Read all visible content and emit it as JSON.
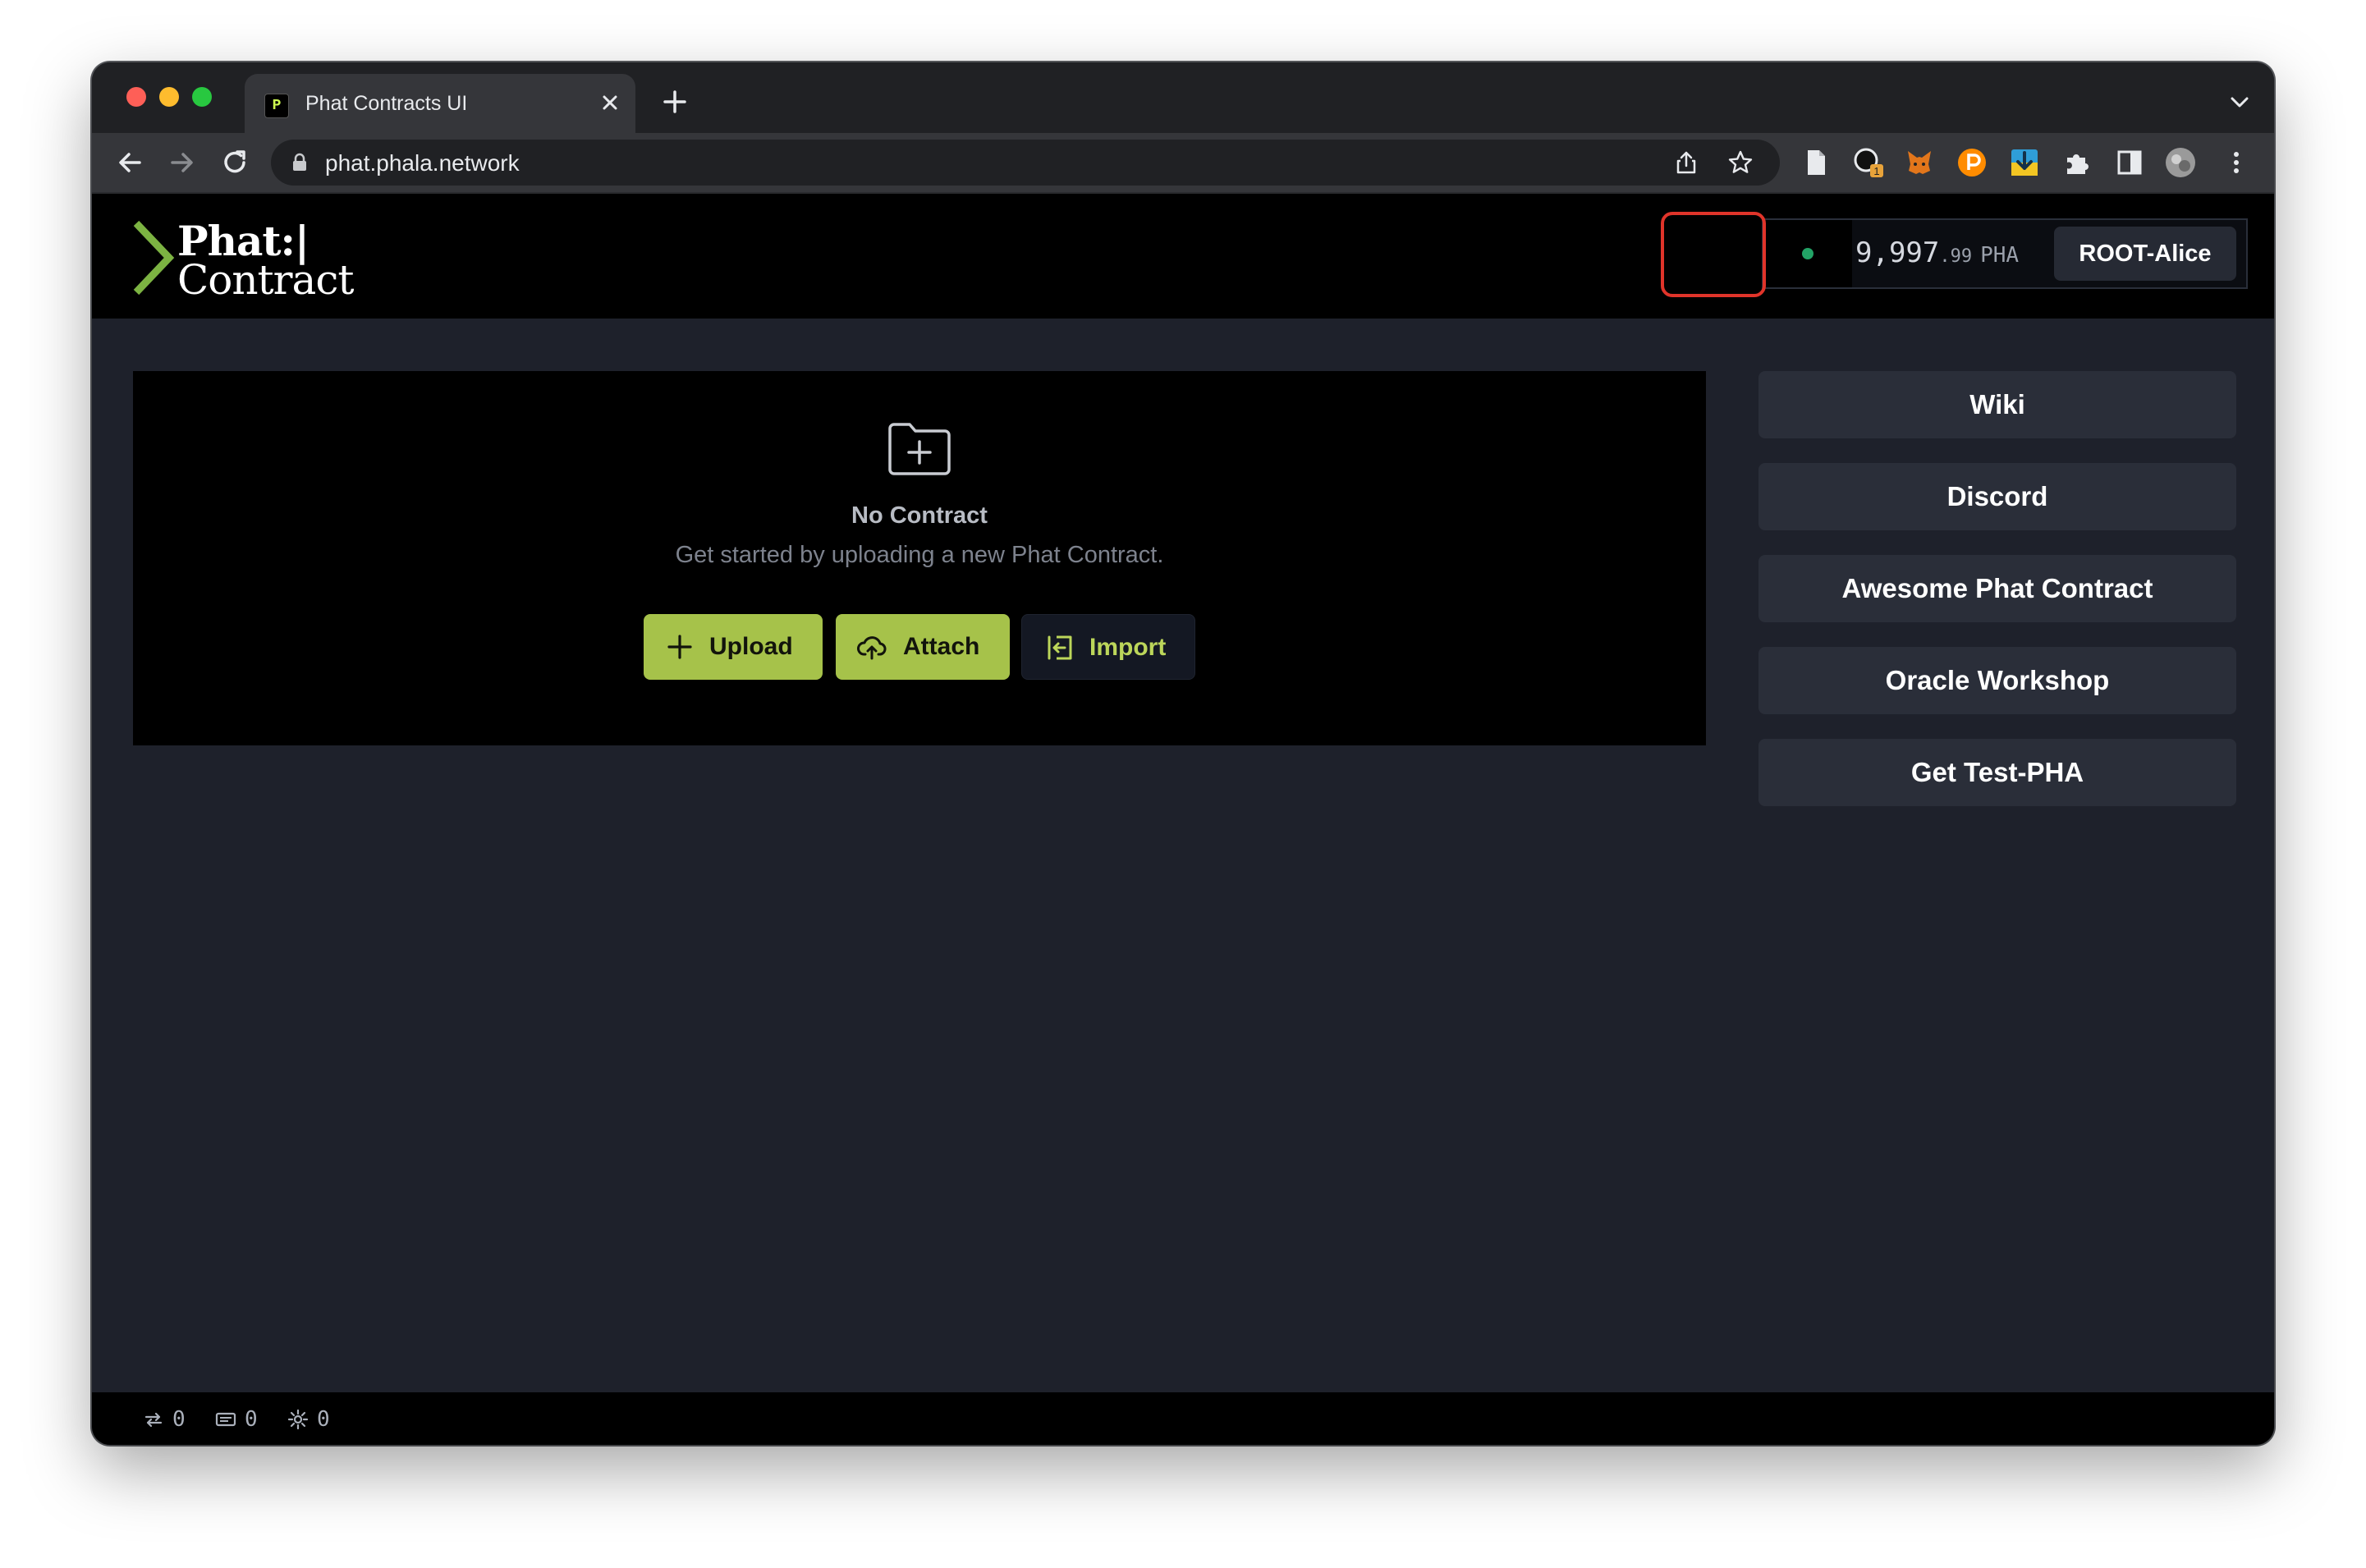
{
  "browser": {
    "tab_title": "Phat Contracts UI",
    "tab_favicon_glyph": "P",
    "url": "phat.phala.network",
    "extension_badge": "1"
  },
  "header": {
    "logo_line1": "Phat:|",
    "logo_line2": "Contract",
    "balance_int": "9,997",
    "balance_dec": ".99",
    "balance_unit": "PHA",
    "account_label": "ROOT-Alice",
    "status_color": "#22a366"
  },
  "main": {
    "empty_title": "No Contract",
    "empty_subtitle": "Get started by uploading a new Phat Contract.",
    "upload_label": "Upload",
    "attach_label": "Attach",
    "import_label": "Import"
  },
  "sidebar": {
    "links": [
      {
        "label": "Wiki"
      },
      {
        "label": "Discord"
      },
      {
        "label": "Awesome Phat Contract"
      },
      {
        "label": "Oracle Workshop"
      },
      {
        "label": "Get Test-PHA"
      }
    ]
  },
  "statusbar": {
    "transactions": "0",
    "messages": "0",
    "settings": "0"
  },
  "colors": {
    "accent": "#a6c24a",
    "highlight": "#e0342a",
    "background": "#1e212b"
  }
}
